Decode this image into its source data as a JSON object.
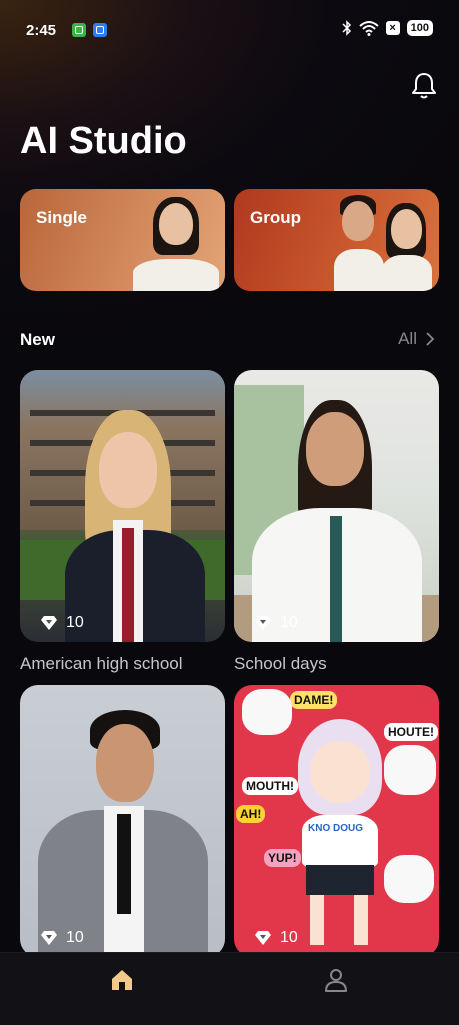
{
  "status_bar": {
    "time": "2:45",
    "battery": "100",
    "icons": [
      "app-notification-icon",
      "app-notification-icon",
      "bluetooth-icon",
      "wifi-icon",
      "x-icon",
      "battery-icon"
    ]
  },
  "header": {
    "title": "AI Studio",
    "bell_icon": "bell-icon"
  },
  "categories": [
    {
      "label": "Single"
    },
    {
      "label": "Group"
    }
  ],
  "new_section": {
    "title": "New",
    "all_label": "All"
  },
  "cards": [
    {
      "caption": "American high school",
      "count": "10"
    },
    {
      "caption": "School days",
      "count": "10"
    },
    {
      "caption": "",
      "count": "10"
    },
    {
      "caption": "",
      "count": "10"
    }
  ],
  "stickers": [
    "DAME!",
    "HOUTE!",
    "AH!",
    "MOUTH!",
    "YUP!",
    "KNO DOUG"
  ],
  "bottom_nav": {
    "items": [
      {
        "name": "home",
        "icon": "home-icon",
        "active": true
      },
      {
        "name": "profile",
        "icon": "profile-icon",
        "active": false
      }
    ]
  },
  "colors": {
    "accent_active": "#f2c98a",
    "inactive_icon": "#8a8690"
  }
}
